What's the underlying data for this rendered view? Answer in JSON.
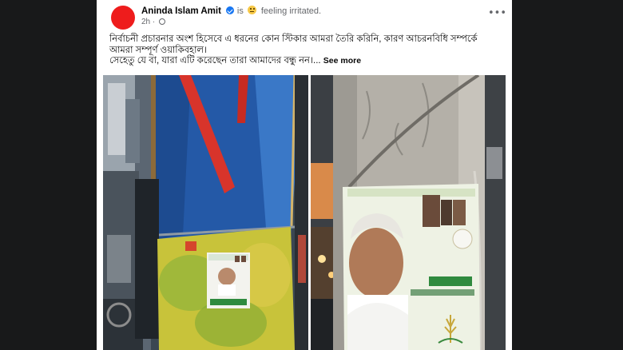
{
  "post": {
    "author": "Aninda Islam Amit",
    "status_is": "is",
    "status_feeling": "feeling irritated.",
    "time": "2h",
    "time_sep": "·",
    "menu": "•••",
    "text_lines": [
      "নির্বাচনী প্রচারনার অংশ হিসেবে এ ধরনের কোন স্টিকার আমরা তৈরি করিনি, কারণ আচরনবিধি সম্পর্কে",
      "আমরা সম্পূর্ণ ওয়াকিবহাল।",
      "সেহেতু যে বা, যারা এটি করেছেন তারা আমাদের বন্ধু নন।..."
    ],
    "see_more": "See more"
  },
  "colors": {
    "page_bg": "#18191a",
    "card_bg": "#ffffff",
    "avatar": "#ee1c1c",
    "verified": "#1877f2",
    "meta_gray": "#65676b"
  },
  "icons": {
    "verified": "verified-badge-icon",
    "feeling": "irritated-emoji-icon",
    "privacy": "globe-icon",
    "menu": "more-options-icon"
  }
}
